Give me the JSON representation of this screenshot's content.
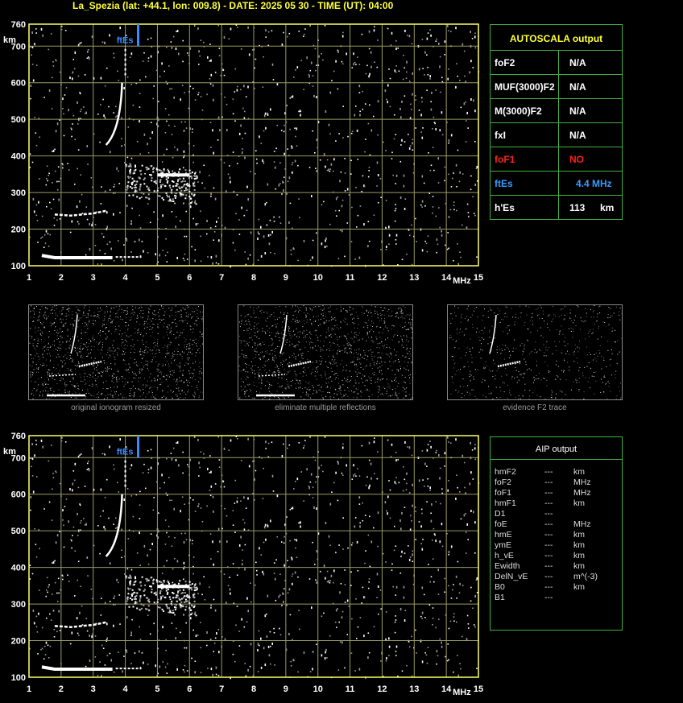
{
  "header": {
    "title": "La_Spezia (lat: +44.1, lon: 009.8) - DATE: 2025 05 30 - TIME (UT): 04:00"
  },
  "ionogram": {
    "y_unit": "km",
    "x_unit": "MHz",
    "y_ticks": [
      "760",
      "700",
      "600",
      "500",
      "400",
      "300",
      "200",
      "100"
    ],
    "x_ticks": [
      "1",
      "2",
      "3",
      "4",
      "5",
      "6",
      "7",
      "8",
      "9",
      "10",
      "11",
      "12",
      "13",
      "14",
      "15"
    ],
    "ftes_marker_label": "ftEs",
    "colors": {
      "grid": "#9a9a66",
      "axis": "#ffff66",
      "trace": "#ffffff",
      "ftes": "#3a8bff"
    }
  },
  "autoscala": {
    "title": "AUTOSCALA output",
    "rows": [
      {
        "key": "foF2",
        "value": "N/A",
        "unit": "",
        "color": "#ffffff"
      },
      {
        "key": "MUF(3000)F2",
        "value": "N/A",
        "unit": "",
        "color": "#ffffff"
      },
      {
        "key": "M(3000)F2",
        "value": "N/A",
        "unit": "",
        "color": "#ffffff"
      },
      {
        "key": "fxI",
        "value": "N/A",
        "unit": "",
        "color": "#ffffff"
      },
      {
        "key": "foF1",
        "value": "NO",
        "unit": "",
        "color": "#ff2020"
      },
      {
        "key": "ftEs",
        "value": "4.4 MHz",
        "unit": "",
        "color": "#3a9bff"
      },
      {
        "key": "h'Es",
        "value": "113",
        "unit": "km",
        "color": "#ffffff"
      }
    ]
  },
  "thumbnails": [
    {
      "caption": "original ionogram resized"
    },
    {
      "caption": "eliminate multiple reflections"
    },
    {
      "caption": "evidence F2 trace"
    }
  ],
  "aip": {
    "title": "AIP output",
    "rows": [
      {
        "key": "hmF2",
        "value": "---",
        "unit": "km"
      },
      {
        "key": "foF2",
        "value": "---",
        "unit": "MHz"
      },
      {
        "key": "foF1",
        "value": "---",
        "unit": "MHz"
      },
      {
        "key": "hmF1",
        "value": "---",
        "unit": "km"
      },
      {
        "key": "D1",
        "value": "---",
        "unit": ""
      },
      {
        "key": "foE",
        "value": "---",
        "unit": "MHz"
      },
      {
        "key": "hmE",
        "value": "---",
        "unit": "km"
      },
      {
        "key": "ymE",
        "value": "---",
        "unit": "km"
      },
      {
        "key": "h_vE",
        "value": "---",
        "unit": "km"
      },
      {
        "key": "Ewidth",
        "value": "---",
        "unit": "km"
      },
      {
        "key": "DelN_vE",
        "value": "---",
        "unit": "m^(-3)"
      },
      {
        "key": "B0",
        "value": "---",
        "unit": "km"
      },
      {
        "key": "B1",
        "value": "---",
        "unit": ""
      }
    ]
  }
}
